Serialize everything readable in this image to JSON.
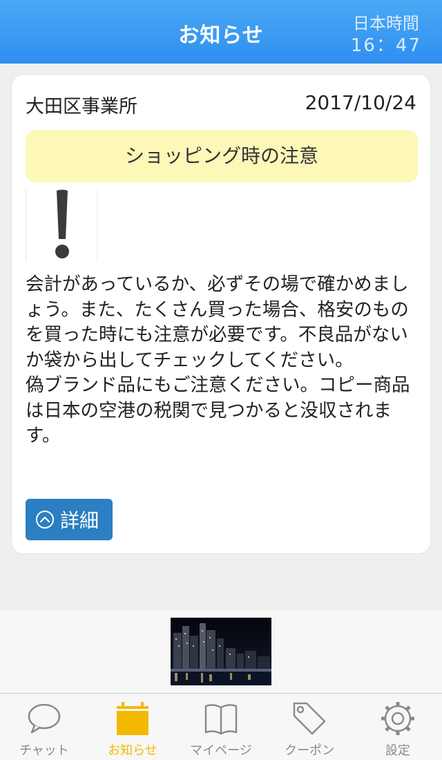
{
  "header": {
    "title": "お知らせ",
    "time_label": "日本時間",
    "time_value": "16：47"
  },
  "notice": {
    "office": "大田区事業所",
    "date": "2017/10/24",
    "subject": "ショッピング時の注意",
    "body": "会計があっているか、必ずその場で確かめましょう。また、たくさん買った場合、格安のものを買った時にも注意が必要です。不良品がないか袋から出してチェックしてください。\n偽ブランド品にもご注意ください。コピー商品は日本の空港の税関で見つかると没収されます。",
    "details_label": "詳細",
    "thumbnail_icon": "exclamation-icon"
  },
  "banner": {
    "icon": "night-city-photo"
  },
  "tabbar": {
    "tabs": [
      {
        "label": "チャット",
        "icon": "chat-bubble-icon"
      },
      {
        "label": "お知らせ",
        "icon": "calendar-icon"
      },
      {
        "label": "マイページ",
        "icon": "book-icon"
      },
      {
        "label": "クーポン",
        "icon": "tag-icon"
      },
      {
        "label": "設定",
        "icon": "gear-icon"
      }
    ],
    "active_index": 1,
    "active_color": "#f5b800",
    "inactive_color": "#8a8a8a"
  },
  "colors": {
    "header": "#3a9cf2",
    "subject_bg": "#fdf8b8",
    "button": "#2b7fc2"
  }
}
